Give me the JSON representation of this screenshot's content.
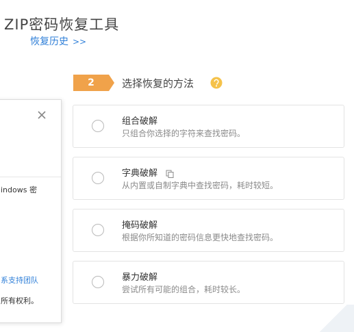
{
  "header": {
    "title": "ZIP密码恢复工具",
    "history_link": "恢复历史",
    "history_arrows": ">>"
  },
  "dialog": {
    "body_text": "indows 密",
    "support_link": "系支持团队",
    "rights": "所有权利。"
  },
  "step": {
    "number": "2",
    "title": "选择恢复的方法",
    "badge_color": "#f0a24a",
    "help_icon_color": "#f5c24a"
  },
  "options": [
    {
      "name": "组合破解",
      "desc": "只组合你选择的字符来查找密码。"
    },
    {
      "name": "字典破解",
      "desc": "从内置或自制字典中查找密码，耗时较短。"
    },
    {
      "name": "掩码破解",
      "desc": "根据你所知道的密码信息更快地查找密码。"
    },
    {
      "name": "暴力破解",
      "desc": "尝试所有可能的组合，耗时较长。"
    }
  ]
}
